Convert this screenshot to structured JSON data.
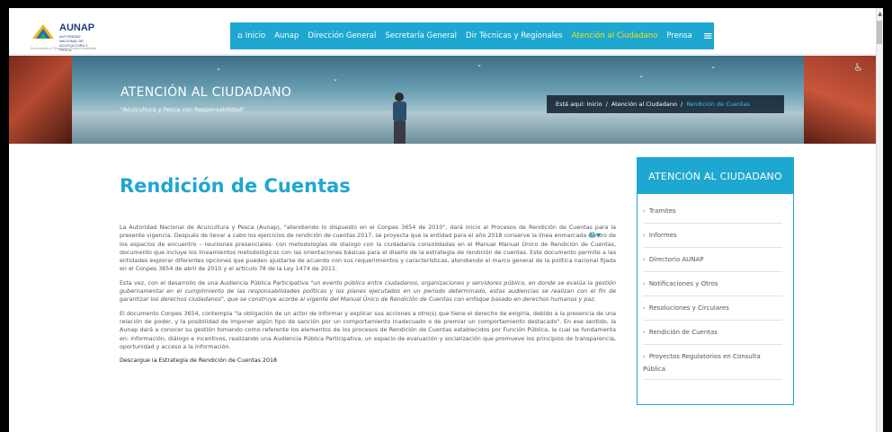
{
  "logo": {
    "title": "AUNAP",
    "subtitle": "AUTORIDAD NACIONAL DE ACUICULTURA Y PESCA",
    "tagline": "Acuicultura y Pesca con Responsabilidad"
  },
  "nav": {
    "items": [
      {
        "label": "Inicio",
        "icon": "home-icon"
      },
      {
        "label": "Aunap"
      },
      {
        "label": "Dirección General"
      },
      {
        "label": "Secretaría General"
      },
      {
        "label": "Dir Técnicas y Regionales"
      },
      {
        "label": "Atención al Ciudadano",
        "active": true
      },
      {
        "label": "Prensa"
      }
    ],
    "menu_icon": "hamburger-menu-icon",
    "color": "#1ea7d1",
    "active_color": "#f3e21c"
  },
  "banner": {
    "title": "ATENCIÓN AL CIUDADANO",
    "subtitle": "\"Acuicultura y Pesca con Responsabilidad\"",
    "breadcrumb": {
      "prefix": "Está aquí:",
      "items": [
        "Inicio",
        "Atención al Ciudadano",
        "Rendición de Cuentas"
      ],
      "separator": "/"
    }
  },
  "main": {
    "title": "Rendición de Cuentas",
    "paragraph1": "La Autoridad Nacional de Acuicultura y Pesca (Aunap), \"atendiendo lo dispuesto en el Conpes 3654 de 2010\", dará inicio al Procesos de Rendición de Cuentas para la presente vigencia. Después de llevar a cabo los ejercicios de rendición de cuentas 2017, se proyecta que la entidad para el año 2018 conserve la línea enmarcada dentro de los espacios de encuentro – reuniones presenciales- con metodologías de dialogo con la ciudadanía consolidadas en el Manual Manual Único de Rendición de Cuentas, documento que incluye los lineamientos metodológicos con las orientaciones básicas para el diseño de la estrategia de rendición de cuentas. Este documento permite a las entidades explorar diferentes opciones que pueden ajustarse de acuerdo con sus requerimientos y características, atendiendo el marco general de la política nacional fijada en el Conpes 3654 de abril de 2010 y el artículo 78 de la Ley 1474 de 2011.",
    "paragraph2_start": "Esta vez, con el desarrollo de una Audiencia Pública Participativa ",
    "paragraph2_italic": "\"un evento público entre ciudadanos, organizaciones y servidores público, en donde se evalúa la gestión gubernamental en el cumplimiento de las responsabilidades políticas y los planes ejecutados en un periodo determinado, estas audiencias se realizan con el fin de garantizar los derechos ciudadanos\", que se construye acorde al vigente del Manual Único de Rendición de Cuentas con enfoque basado en derechos humanos y paz.",
    "paragraph3": "El documento Conpes 3654, contempla \"la obligación de un actor de informar y explicar sus acciones a otro(s) que tiene el derecho de exigirla, debido a la presencia de una relación de poder, y la posibilidad de imponer algún tipo de sanción por un comportamiento inadecuado o de premiar un comportamiento destacado\". En ese sentido, la Aunap dará a conocer su gestión tomando como referente los elementos de los procesos de Rendición de Cuentas establecidos por Función Pública, la cual se fundamenta en: información, diálogo e incentivos, realizando una Audiencia Pública Participativa, un espacio de evaluación y socialización que promueve los principios de transparencia, oportunidad y acceso a la información.",
    "download_link": "Descargue la Estrategia de Rendición de Cuentas 2018",
    "gear_icon": "gear-icon"
  },
  "sidebar": {
    "title": "ATENCIÓN AL CIUDADANO",
    "items": [
      "Tramites",
      "Informes",
      "Directorio AUNAP",
      "Notificaciones y Otros",
      "Resoluciones y Circulares",
      "Rendición de Cuentas",
      "Proyectos Regulatorios en Consulta Pública"
    ]
  }
}
